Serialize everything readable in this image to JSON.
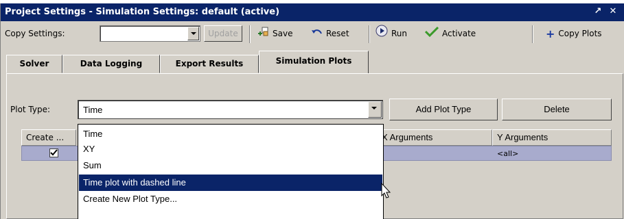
{
  "window": {
    "title": "Project Settings - Simulation Settings: default (active)",
    "pin_glyph": "↗",
    "close_glyph": "✕"
  },
  "toolbar": {
    "copy_settings_label": "Copy Settings:",
    "copy_settings_value": "",
    "update_label": "Update",
    "save_label": "Save",
    "reset_label": "Reset",
    "run_label": "Run",
    "activate_label": "Activate",
    "copy_plots_label": "Copy Plots"
  },
  "tabs": [
    {
      "label": "Solver",
      "active": false
    },
    {
      "label": "Data Logging",
      "active": false
    },
    {
      "label": "Export Results",
      "active": false
    },
    {
      "label": "Simulation Plots",
      "active": true
    }
  ],
  "plot_type": {
    "label": "Plot Type:",
    "value": "Time",
    "add_button": "Add Plot Type",
    "delete_button": "Delete"
  },
  "table": {
    "headers": [
      "Create ...",
      "X Arguments",
      "Y Arguments"
    ],
    "rows": [
      {
        "create_checked": true,
        "x_arguments": "",
        "y_arguments": "<all>"
      }
    ]
  },
  "dropdown": {
    "options": [
      "Time",
      "XY",
      "Sum",
      "Time plot with dashed line",
      "Create New Plot Type..."
    ],
    "highlighted_index": 3
  },
  "colors": {
    "title_bar": "#0a2468",
    "selection_highlight": "#0a2468",
    "selected_row": "#a8abcd",
    "chrome": "#d4d0c8"
  }
}
